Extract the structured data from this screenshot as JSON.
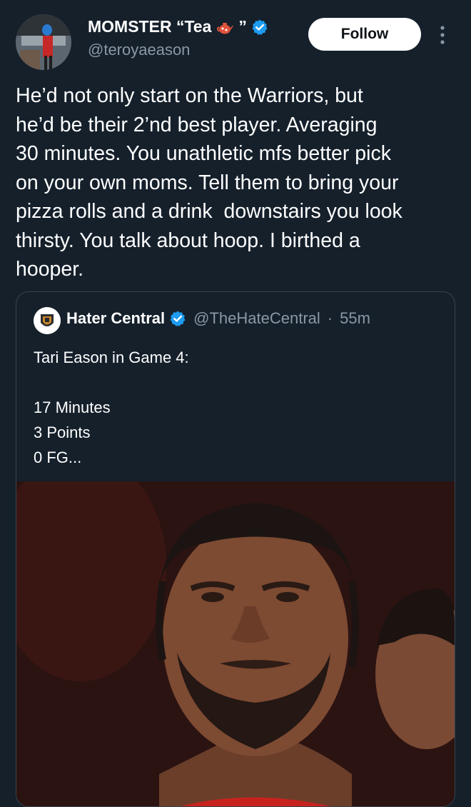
{
  "author": {
    "display_name": "MOMSTER “Tea",
    "display_name_suffix": "”",
    "handle": "@teroyaeason",
    "verified": true
  },
  "follow_label": "Follow",
  "tweet_text": "He’d not only start on the Warriors, but\nhe’d be their 2’nd best player. Averaging\n30 minutes. You unathletic mfs better pick\non your own moms. Tell them to bring your\npizza rolls and a drink  downstairs you look\nthirsty. You talk about hoop. I birthed a\nhooper.",
  "quote": {
    "name": "Hater Central",
    "handle": "@TheHateCentral",
    "separator": "·",
    "time": "55m",
    "text": "Tari Eason in Game 4:\n\n17 Minutes\n3 Points\n0 FG..."
  },
  "colors": {
    "background": "#15202b",
    "text": "#ffffff",
    "muted": "#8b98a5",
    "verified": "#1d9bf0",
    "border": "#38444d"
  },
  "icons": [
    "verified-badge-icon",
    "teapot-emoji-icon",
    "more-options-icon"
  ]
}
